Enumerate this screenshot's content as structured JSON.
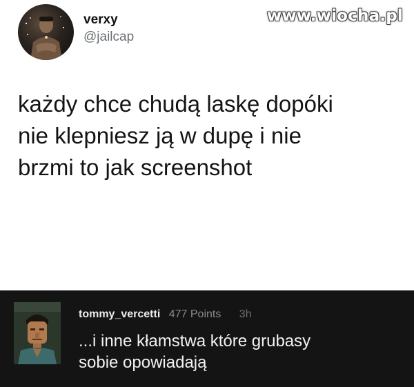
{
  "watermark": {
    "text": "www.wiocha.pl"
  },
  "tweet": {
    "display_name": "verxy",
    "handle": "@jailcap",
    "text_lines": [
      "każdy chce chudą laskę dopóki",
      "nie klepniesz ją w dupę i nie",
      "brzmi to jak screenshot"
    ]
  },
  "comment": {
    "username": "tommy_vercetti",
    "points": "477 Points",
    "time": "3h",
    "text_lines": [
      "...i inne kłamstwa które grubasy",
      "sobie opowiadają"
    ]
  },
  "colors": {
    "page_background": "#ffffff",
    "tweet_text": "#141414",
    "handle": "#6a6f73",
    "comment_background": "#141414",
    "comment_text": "#f2f2f2",
    "comment_meta": "#8a8a8a"
  }
}
